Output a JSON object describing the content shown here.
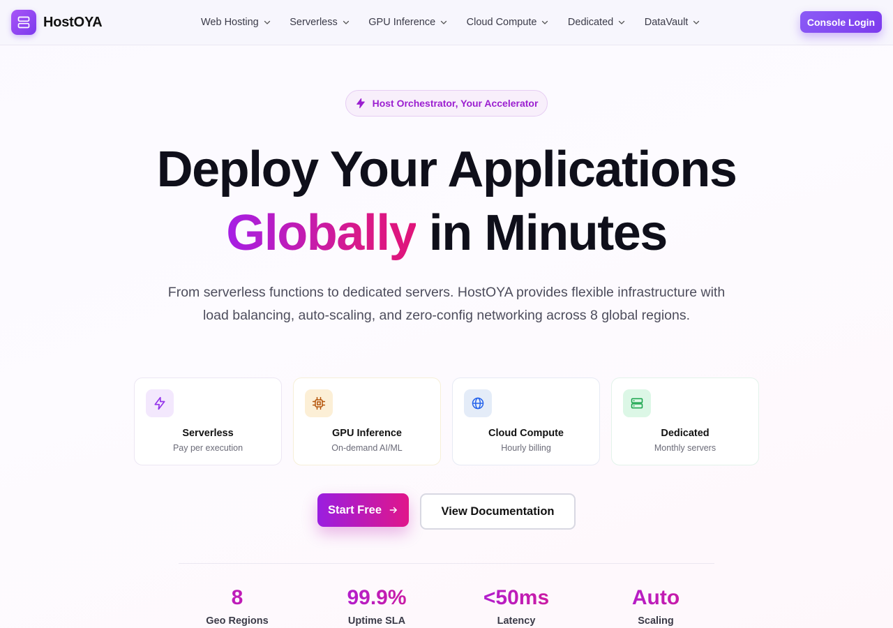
{
  "brand": {
    "name": "HostOYA",
    "logo_icon": "server-icon"
  },
  "nav": {
    "items": [
      {
        "label": "Web Hosting"
      },
      {
        "label": "Serverless"
      },
      {
        "label": "GPU Inference"
      },
      {
        "label": "Cloud Compute"
      },
      {
        "label": "Dedicated"
      },
      {
        "label": "DataVault"
      }
    ],
    "console_login": "Console Login"
  },
  "hero": {
    "badge": "Host Orchestrator, Your Accelerator",
    "title_line1": "Deploy Your Applications",
    "title_highlight": "Globally",
    "title_rest": " in Minutes",
    "subtitle": "From serverless functions to dedicated servers. HostOYA provides flexible infrastructure with load balancing, auto-scaling, and zero-config networking across 8 global regions."
  },
  "cards": [
    {
      "title": "Serverless",
      "subtitle": "Pay per execution",
      "icon": "bolt-icon",
      "icon_color": "#9333ea",
      "icon_bg": "#f3e8fd",
      "border": "#ece6f3"
    },
    {
      "title": "GPU Inference",
      "subtitle": "On-demand AI/ML",
      "icon": "chip-icon",
      "icon_color": "#b45309",
      "icon_bg": "#fcefd6",
      "border": "#f6efd8"
    },
    {
      "title": "Cloud Compute",
      "subtitle": "Hourly billing",
      "icon": "globe-icon",
      "icon_color": "#2563eb",
      "icon_bg": "#e4ecf8",
      "border": "#e6eaf4"
    },
    {
      "title": "Dedicated",
      "subtitle": "Monthly servers",
      "icon": "server-icon",
      "icon_color": "#16a34a",
      "icon_bg": "#dcf7e6",
      "border": "#e2f3ea"
    }
  ],
  "cta": {
    "primary": "Start Free",
    "secondary": "View Documentation"
  },
  "stats": [
    {
      "value": "8",
      "label": "Geo Regions"
    },
    {
      "value": "99.9%",
      "label": "Uptime SLA"
    },
    {
      "value": "<50ms",
      "label": "Latency"
    },
    {
      "value": "Auto",
      "label": "Scaling"
    }
  ],
  "colors": {
    "accent": "#7c3aed",
    "gradient_start": "#a51fe6",
    "gradient_end": "#e0157a"
  }
}
